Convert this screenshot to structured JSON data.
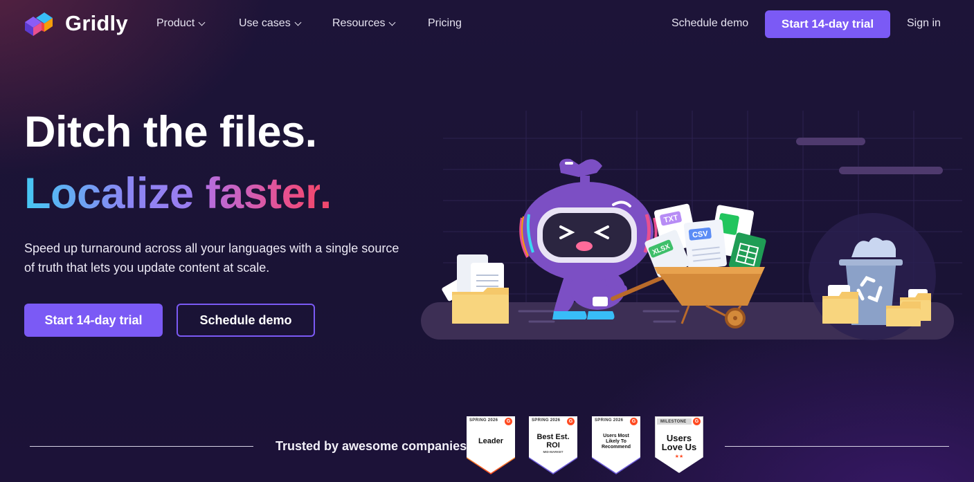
{
  "brand": {
    "name": "Gridly"
  },
  "nav": {
    "items": [
      {
        "label": "Product",
        "has_dropdown": true
      },
      {
        "label": "Use cases",
        "has_dropdown": true
      },
      {
        "label": "Resources",
        "has_dropdown": true
      },
      {
        "label": "Pricing",
        "has_dropdown": false
      }
    ],
    "schedule_demo": "Schedule demo",
    "start_trial": "Start 14-day trial",
    "sign_in": "Sign in"
  },
  "hero": {
    "title_line1": "Ditch the files.",
    "title_line2_word1": "Localize",
    "title_line2_word2": "faster",
    "title_line2_dot": ".",
    "subtitle": "Speed up turnaround across all your languages with a single source of truth that lets you update content at scale.",
    "primary_cta": "Start 14-day trial",
    "secondary_cta": "Schedule demo"
  },
  "illustration": {
    "file_labels": [
      "TXT",
      "CSV",
      "XLSX"
    ]
  },
  "trusted": {
    "label": "Trusted by awesome companies",
    "badges": [
      {
        "top": "SPRING 2026",
        "main": "Leader",
        "sub": "",
        "stripe": "#ff7a2a"
      },
      {
        "top": "SPRING 2026",
        "main": "Best Est. ROI",
        "sub": "MID-MARKET",
        "stripe": "#6c5ad8"
      },
      {
        "top": "SPRING 2026",
        "main": "Users Most Likely To Recommend",
        "sub": "",
        "stripe": "#6c5ad8"
      },
      {
        "top": "MILESTONE",
        "main": "Users Love Us",
        "sub": "",
        "stripe": ""
      }
    ]
  },
  "colors": {
    "accent": "#7b5af5",
    "background": "#1a1236",
    "cyan": "#38d8f2",
    "pink": "#e8508f"
  }
}
